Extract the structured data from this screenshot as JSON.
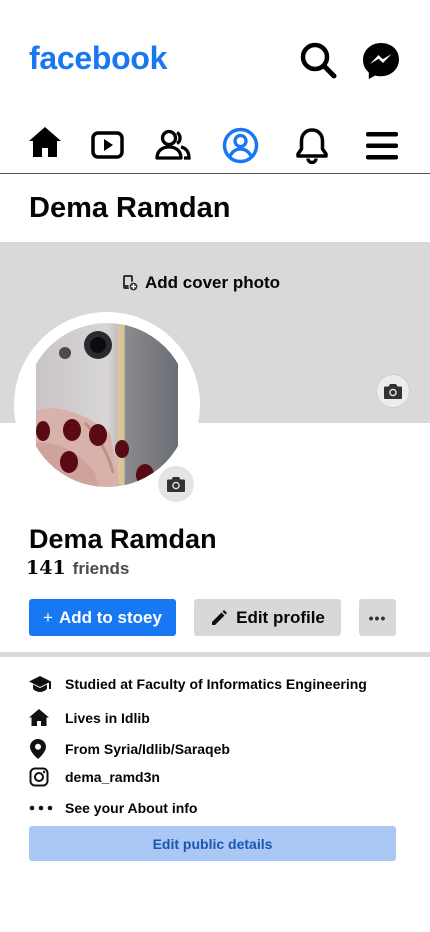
{
  "app": {
    "logo": "facebook"
  },
  "header": {
    "search_icon": "search-icon",
    "messenger_icon": "messenger-icon"
  },
  "nav": {
    "items": [
      {
        "name": "home",
        "icon": "home-icon"
      },
      {
        "name": "watch",
        "icon": "video-icon"
      },
      {
        "name": "friends",
        "icon": "friends-icon"
      },
      {
        "name": "profile",
        "icon": "profile-icon",
        "active": true
      },
      {
        "name": "notifications",
        "icon": "bell-icon"
      },
      {
        "name": "menu",
        "icon": "menu-icon"
      }
    ],
    "active_color": "#1877f2"
  },
  "profile": {
    "header_name": "Dema Ramdan",
    "cover_label": "Add cover photo",
    "name": "Dema Ramdan",
    "friends_count": "141",
    "friends_label": "friends"
  },
  "actions": {
    "add_story": "Add to stoey",
    "add_story_prefix": "+",
    "edit_profile": "Edit profile",
    "more": "•••"
  },
  "about": {
    "items": [
      {
        "icon": "graduation-cap-icon",
        "text": "Studied at Faculty of Informatics Engineering"
      },
      {
        "icon": "home-icon",
        "text": "Lives in Idlib"
      },
      {
        "icon": "location-pin-icon",
        "text": "From Syria/Idlib/Saraqeb"
      },
      {
        "icon": "instagram-icon",
        "text": "dema_ramd3n"
      },
      {
        "icon": "more-icon",
        "text": "See your About info"
      }
    ],
    "edit_details": "Edit public details"
  },
  "colors": {
    "brand": "#1877f2",
    "cover_bg": "#d9d9d9",
    "secondary_btn": "#d8d8d8",
    "edit_details_bg": "#a9c8f5"
  }
}
